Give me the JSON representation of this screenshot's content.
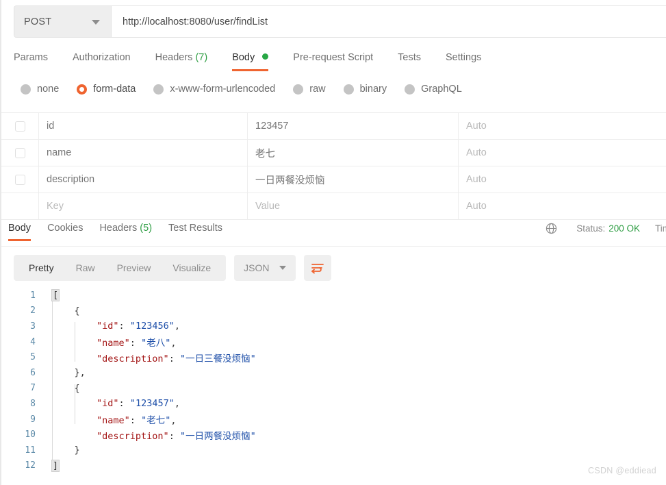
{
  "request": {
    "method": "POST",
    "url": "http://localhost:8080/user/findList",
    "tabs": [
      {
        "label": "Params",
        "active": false
      },
      {
        "label": "Authorization",
        "active": false
      },
      {
        "label": "Headers",
        "count": "(7)",
        "active": false
      },
      {
        "label": "Body",
        "active": true,
        "dot": true
      },
      {
        "label": "Pre-request Script",
        "active": false
      },
      {
        "label": "Tests",
        "active": false
      },
      {
        "label": "Settings",
        "active": false
      }
    ],
    "body_types": [
      {
        "label": "none",
        "selected": false
      },
      {
        "label": "form-data",
        "selected": true
      },
      {
        "label": "x-www-form-urlencoded",
        "selected": false
      },
      {
        "label": "raw",
        "selected": false
      },
      {
        "label": "binary",
        "selected": false
      },
      {
        "label": "GraphQL",
        "selected": false
      }
    ],
    "table": {
      "rows": [
        {
          "key": "id",
          "value": "123457",
          "desc": "Auto",
          "checkbox": true,
          "placeholder": false
        },
        {
          "key": "name",
          "value": "老七",
          "desc": "Auto",
          "checkbox": true,
          "placeholder": false
        },
        {
          "key": "description",
          "value": "一日两餐没烦恼",
          "desc": "Auto",
          "checkbox": true,
          "placeholder": false
        },
        {
          "key": "Key",
          "value": "Value",
          "desc": "Auto",
          "checkbox": false,
          "placeholder": true
        }
      ]
    }
  },
  "response": {
    "tabs": [
      {
        "label": "Body",
        "active": true
      },
      {
        "label": "Cookies",
        "active": false
      },
      {
        "label": "Headers",
        "count": "(5)",
        "active": false
      },
      {
        "label": "Test Results",
        "active": false
      }
    ],
    "status_label": "Status:",
    "status_value": "200 OK",
    "time_label": "Tim",
    "view_buttons": [
      {
        "label": "Pretty",
        "active": true
      },
      {
        "label": "Raw",
        "active": false
      },
      {
        "label": "Preview",
        "active": false
      },
      {
        "label": "Visualize",
        "active": false
      }
    ],
    "format": "JSON",
    "code_lines": [
      {
        "n": "1",
        "indent": 0,
        "tokens": [
          {
            "t": "bracket",
            "v": "["
          }
        ]
      },
      {
        "n": "2",
        "indent": 0,
        "tokens": [
          {
            "t": "pun",
            "v": "    {"
          }
        ]
      },
      {
        "n": "3",
        "indent": 0,
        "tokens": [
          {
            "t": "key",
            "v": "        \"id\""
          },
          {
            "t": "pun",
            "v": ": "
          },
          {
            "t": "str",
            "v": "\"123456\""
          },
          {
            "t": "pun",
            "v": ","
          }
        ]
      },
      {
        "n": "4",
        "indent": 0,
        "tokens": [
          {
            "t": "key",
            "v": "        \"name\""
          },
          {
            "t": "pun",
            "v": ": "
          },
          {
            "t": "str",
            "v": "\"老八\""
          },
          {
            "t": "pun",
            "v": ","
          }
        ]
      },
      {
        "n": "5",
        "indent": 0,
        "tokens": [
          {
            "t": "key",
            "v": "        \"description\""
          },
          {
            "t": "pun",
            "v": ": "
          },
          {
            "t": "str",
            "v": "\"一日三餐没烦恼\""
          }
        ]
      },
      {
        "n": "6",
        "indent": 0,
        "tokens": [
          {
            "t": "pun",
            "v": "    },"
          }
        ]
      },
      {
        "n": "7",
        "indent": 0,
        "tokens": [
          {
            "t": "pun",
            "v": "    {"
          }
        ]
      },
      {
        "n": "8",
        "indent": 0,
        "tokens": [
          {
            "t": "key",
            "v": "        \"id\""
          },
          {
            "t": "pun",
            "v": ": "
          },
          {
            "t": "str",
            "v": "\"123457\""
          },
          {
            "t": "pun",
            "v": ","
          }
        ]
      },
      {
        "n": "9",
        "indent": 0,
        "tokens": [
          {
            "t": "key",
            "v": "        \"name\""
          },
          {
            "t": "pun",
            "v": ": "
          },
          {
            "t": "str",
            "v": "\"老七\""
          },
          {
            "t": "pun",
            "v": ","
          }
        ]
      },
      {
        "n": "10",
        "indent": 0,
        "tokens": [
          {
            "t": "key",
            "v": "        \"description\""
          },
          {
            "t": "pun",
            "v": ": "
          },
          {
            "t": "str",
            "v": "\"一日两餐没烦恼\""
          }
        ]
      },
      {
        "n": "11",
        "indent": 0,
        "tokens": [
          {
            "t": "pun",
            "v": "    }"
          }
        ]
      },
      {
        "n": "12",
        "indent": 0,
        "tokens": [
          {
            "t": "bracket",
            "v": "]"
          }
        ]
      }
    ]
  },
  "watermark": "CSDN @eddiead",
  "colors": {
    "accent": "#ef6430",
    "success": "#2f9e44",
    "json_key": "#a31515",
    "json_string": "#1d4ea8",
    "line_number": "#5c8aa8"
  }
}
